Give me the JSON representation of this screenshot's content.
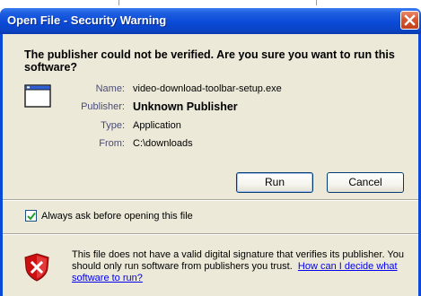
{
  "dialog": {
    "title": "Open File - Security Warning",
    "question": "The publisher could not be verified.  Are you sure you want to run this software?",
    "details": [
      {
        "label": "Name:",
        "value": "video-download-toolbar-setup.exe"
      },
      {
        "label": "Publisher:",
        "value": "Unknown Publisher"
      },
      {
        "label": "Type:",
        "value": "Application"
      },
      {
        "label": "From:",
        "value": "C:\\downloads"
      }
    ],
    "buttons": {
      "run": "Run",
      "cancel": "Cancel"
    },
    "checkbox": {
      "label": "Always ask before opening this file",
      "checked": true
    },
    "warning": {
      "text": "This file does not have a valid digital signature that verifies its publisher. You should only run software from publishers you trust.",
      "link": "How can I decide what software to run?"
    }
  },
  "icons": [
    "close-icon",
    "application-icon",
    "checkmark-icon",
    "shield-warning-icon"
  ],
  "colors": {
    "titlebar": "#0a4ad8",
    "dialog_bg": "#ece9d8",
    "close_button": "#d7552f",
    "link": "#0000ee",
    "shield": "#cc1010"
  }
}
